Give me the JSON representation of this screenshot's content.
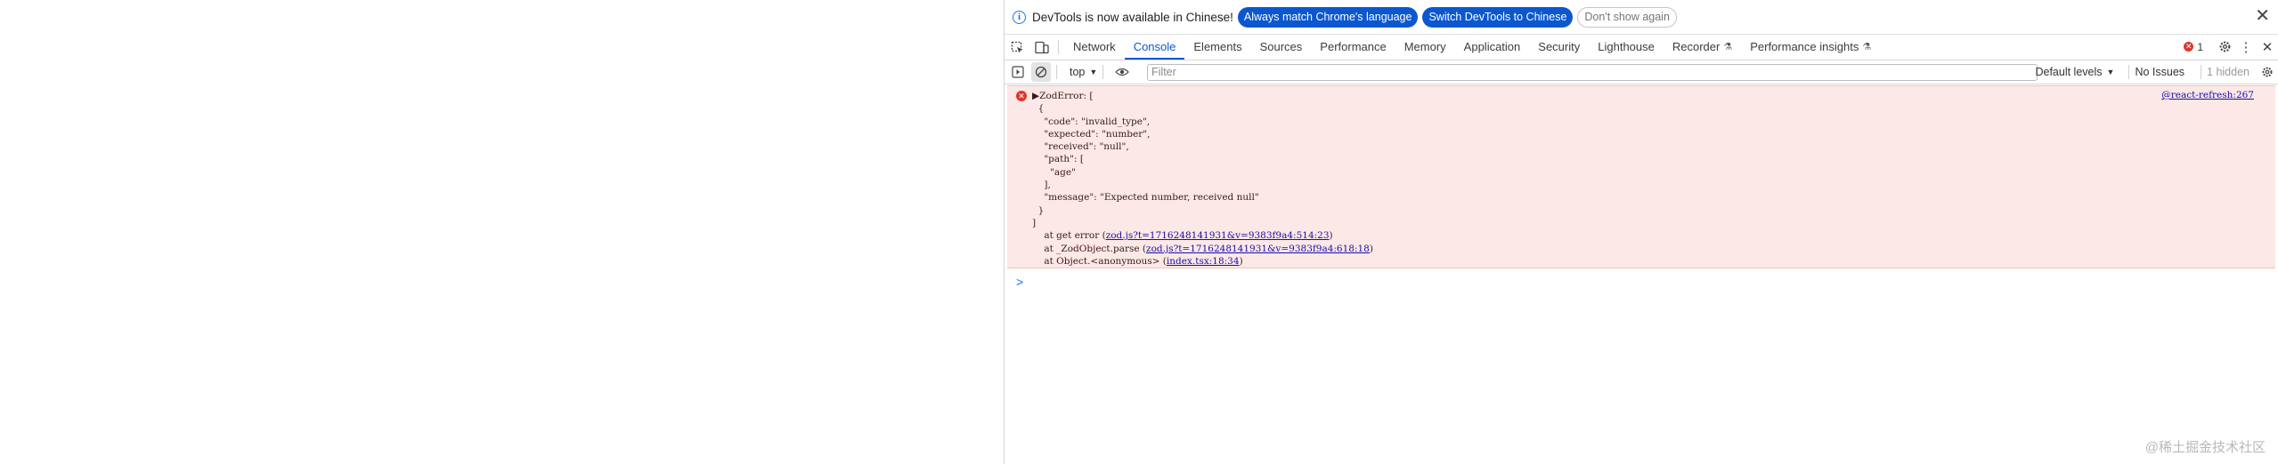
{
  "infobar": {
    "message": "DevTools is now available in Chinese!",
    "match_button": "Always match Chrome's language",
    "switch_button": "Switch DevTools to Chinese",
    "dismiss_button": "Don't show again"
  },
  "tabs": [
    {
      "label": "Network"
    },
    {
      "label": "Console"
    },
    {
      "label": "Elements"
    },
    {
      "label": "Sources"
    },
    {
      "label": "Performance"
    },
    {
      "label": "Memory"
    },
    {
      "label": "Application"
    },
    {
      "label": "Security"
    },
    {
      "label": "Lighthouse"
    },
    {
      "label": "Recorder"
    },
    {
      "label": "Performance insights"
    }
  ],
  "active_tab": "Console",
  "error_badge_count": "1",
  "toolbar": {
    "context": "top",
    "filter_placeholder": "Filter",
    "levels": "Default levels",
    "issues": "No Issues",
    "hidden": "1 hidden"
  },
  "error_message": {
    "source": "@react-refresh:267",
    "lines": [
      "ZodError: [",
      "  {",
      "    \"code\": \"invalid_type\",",
      "    \"expected\": \"number\",",
      "    \"received\": \"null\",",
      "    \"path\": [",
      "      \"age\"",
      "    ],",
      "    \"message\": \"Expected number, received null\"",
      "  }",
      "]"
    ],
    "stack": [
      {
        "prefix": "    at get error (",
        "link": "zod.js?t=1716248141931&v=9383f9a4:514:23",
        "suffix": ")"
      },
      {
        "prefix": "    at _ZodObject.parse (",
        "link": "zod.js?t=1716248141931&v=9383f9a4:618:18",
        "suffix": ")"
      },
      {
        "prefix": "    at Object.<anonymous> (",
        "link": "index.tsx:18:34",
        "suffix": ")"
      }
    ]
  },
  "prompt_symbol": ">",
  "watermark": "@稀土掘金技术社区",
  "colors": {
    "accent": "#0b57d0",
    "error_background": "#fce8e6",
    "error_icon": "#dc362e"
  }
}
